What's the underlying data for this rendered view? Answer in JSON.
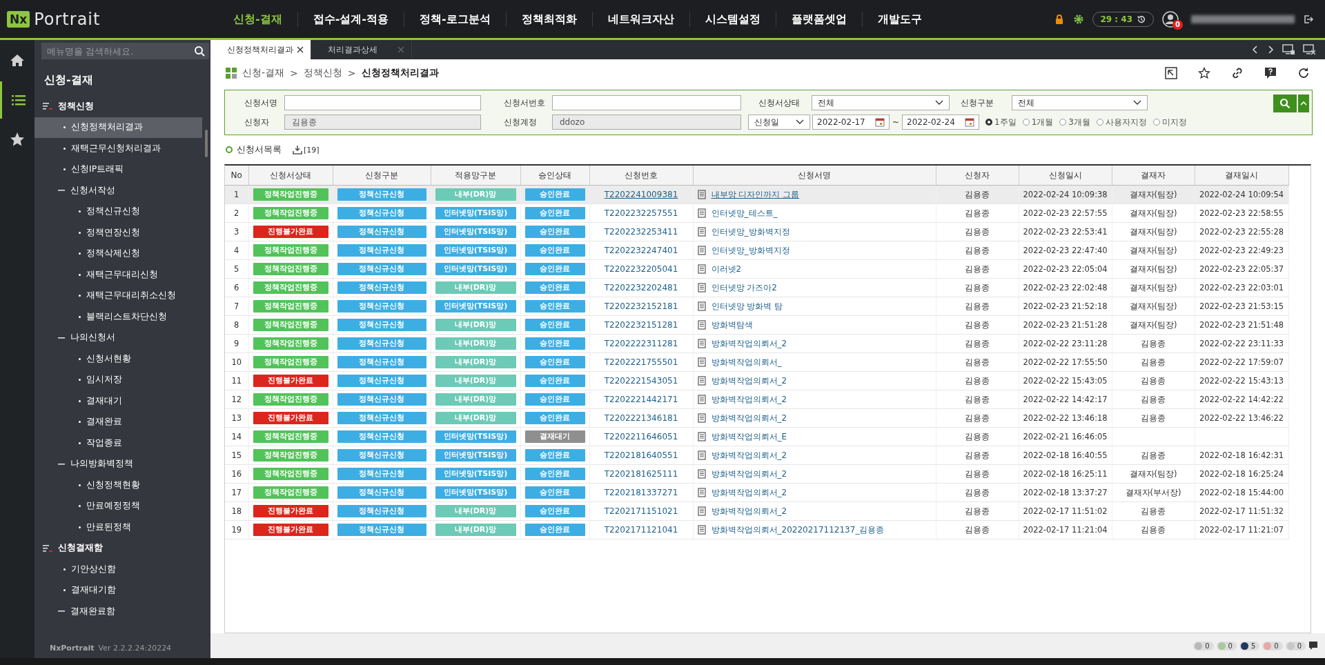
{
  "topbar": {
    "logo_mark": "Nx",
    "logo_text": "Portrait",
    "menu": [
      {
        "label": "신청-결재",
        "selected": true
      },
      {
        "label": "접수-설계-적용",
        "selected": false
      },
      {
        "label": "정책-로그분석",
        "selected": false
      },
      {
        "label": "정책최적화",
        "selected": false
      },
      {
        "label": "네트워크자산",
        "selected": false
      },
      {
        "label": "시스템설정",
        "selected": false
      },
      {
        "label": "플랫폼셋업",
        "selected": false
      },
      {
        "label": "개발도구",
        "selected": false
      }
    ],
    "timer": "29 : 43",
    "notification_count": "0"
  },
  "sidebar": {
    "search": {
      "placeholder": "메뉴명을 검색하세요."
    },
    "title": "신청-결재",
    "tree": [
      {
        "label": "정책신청",
        "kind": "group",
        "children": [
          {
            "label": "신청정책처리결과",
            "kind": "leaf",
            "selected": true
          },
          {
            "label": "재택근무신청처리결과",
            "kind": "leaf",
            "selected": false
          },
          {
            "label": "신청IP트래픽",
            "kind": "leaf",
            "selected": false
          },
          {
            "label": "신청서작성",
            "kind": "folder",
            "expanded": true,
            "children": [
              {
                "label": "정책신규신청",
                "kind": "leaf",
                "selected": false
              },
              {
                "label": "정책연장신청",
                "kind": "leaf",
                "selected": false
              },
              {
                "label": "정책삭제신청",
                "kind": "leaf",
                "selected": false
              },
              {
                "label": "재택근무대리신청",
                "kind": "leaf",
                "selected": false
              },
              {
                "label": "재택근무대리취소신청",
                "kind": "leaf",
                "selected": false
              },
              {
                "label": "블랙리스트차단신청",
                "kind": "leaf",
                "selected": false
              }
            ]
          },
          {
            "label": "나의신청서",
            "kind": "folder",
            "expanded": true,
            "children": [
              {
                "label": "신청서현황",
                "kind": "leaf",
                "selected": false
              },
              {
                "label": "임시저장",
                "kind": "leaf",
                "selected": false
              },
              {
                "label": "결재대기",
                "kind": "leaf",
                "selected": false
              },
              {
                "label": "결재완료",
                "kind": "leaf",
                "selected": false
              },
              {
                "label": "작업종료",
                "kind": "leaf",
                "selected": false
              }
            ]
          },
          {
            "label": "나의방화벽정책",
            "kind": "folder",
            "expanded": true,
            "children": [
              {
                "label": "신청정책현황",
                "kind": "leaf",
                "selected": false
              },
              {
                "label": "만료예정정책",
                "kind": "leaf",
                "selected": false
              },
              {
                "label": "만료된정책",
                "kind": "leaf",
                "selected": false
              }
            ]
          }
        ]
      },
      {
        "label": "신청결재함",
        "kind": "group",
        "children": [
          {
            "label": "기안상신함",
            "kind": "leaf",
            "selected": false
          },
          {
            "label": "결재대기함",
            "kind": "leaf",
            "selected": false
          },
          {
            "label": "결재완료함",
            "kind": "folder",
            "expanded": true
          }
        ]
      }
    ],
    "product": "NxPortrait",
    "version": "Ver 2.2.2.24:20224"
  },
  "tabs": [
    {
      "label": "신청정책처리결과",
      "selected": true
    },
    {
      "label": "처리결과상세",
      "selected": false
    }
  ],
  "breadcrumb": {
    "items": [
      "신청-결재",
      "정책신청",
      "신청정책처리결과"
    ],
    "separator": ">"
  },
  "filters": {
    "row1": [
      {
        "label": "신청서명",
        "kind": "input"
      },
      {
        "label": "신청서번호",
        "kind": "input"
      },
      {
        "label": "신청서상태",
        "kind": "select",
        "value": "전체"
      },
      {
        "label": "신청구분",
        "kind": "select",
        "value": "전체"
      }
    ],
    "row2": [
      {
        "label": "신청자",
        "kind": "readonly",
        "value": "김용종"
      },
      {
        "label": "신청계정",
        "kind": "readonly",
        "value": "ddozo"
      }
    ],
    "date_type": "신청일",
    "date_from": "2022-02-17",
    "date_sep": "~",
    "date_to": "2022-02-24",
    "periods": [
      {
        "label": "1주일",
        "selected": true
      },
      {
        "label": "1개월",
        "selected": false
      },
      {
        "label": "3개월",
        "selected": false
      },
      {
        "label": "사용자지정",
        "selected": false
      },
      {
        "label": "미지정",
        "selected": false
      }
    ]
  },
  "list": {
    "title": "신청서목록",
    "count": "[19]"
  },
  "table": {
    "columns": [
      "No",
      "신청서상태",
      "신청구분",
      "적용망구분",
      "승인상태",
      "신청번호",
      "신청서명",
      "신청자",
      "신청일시",
      "결재자",
      "결재일시"
    ],
    "rows": [
      {
        "no": "1",
        "selected": true,
        "status": {
          "text": "정책작업진행중",
          "kind": "progress"
        },
        "type": "정책신규신청",
        "network": {
          "text": "내부(DR)망",
          "kind": "internal"
        },
        "approval": {
          "text": "승인완료",
          "kind": "done"
        },
        "number": "T2202241009381",
        "name": "내부망 디자인까지 그룹",
        "applicant": "김용종",
        "applied_at": "2022-02-24 10:09:38",
        "approver": "결재자(팀장)",
        "approved_at": "2022-02-24 10:09:54"
      },
      {
        "no": "2",
        "selected": false,
        "status": {
          "text": "정책작업진행중",
          "kind": "progress"
        },
        "type": "정책신규신청",
        "network": {
          "text": "인터넷망(TSIS망)",
          "kind": "internet"
        },
        "approval": {
          "text": "승인완료",
          "kind": "done"
        },
        "number": "T2202232257551",
        "name": "인터넷망_테스트_",
        "applicant": "김용종",
        "applied_at": "2022-02-23 22:57:55",
        "approver": "결재자(팀장)",
        "approved_at": "2022-02-23 22:58:55"
      },
      {
        "no": "3",
        "selected": false,
        "status": {
          "text": "진행불가완료",
          "kind": "failed"
        },
        "type": "정책신규신청",
        "network": {
          "text": "인터넷망(TSIS망)",
          "kind": "internet"
        },
        "approval": {
          "text": "승인완료",
          "kind": "done"
        },
        "number": "T2202232253411",
        "name": "인터넷망_방화벽지정",
        "applicant": "김용종",
        "applied_at": "2022-02-23 22:53:41",
        "approver": "결재자(팀장)",
        "approved_at": "2022-02-23 22:55:28"
      },
      {
        "no": "4",
        "selected": false,
        "status": {
          "text": "정책작업진행중",
          "kind": "progress"
        },
        "type": "정책신규신청",
        "network": {
          "text": "인터넷망(TSIS망)",
          "kind": "internet"
        },
        "approval": {
          "text": "승인완료",
          "kind": "done"
        },
        "number": "T2202232247401",
        "name": "인터넷망_방화벽지정",
        "applicant": "김용종",
        "applied_at": "2022-02-23 22:47:40",
        "approver": "결재자(팀장)",
        "approved_at": "2022-02-23 22:49:23"
      },
      {
        "no": "5",
        "selected": false,
        "status": {
          "text": "정책작업진행중",
          "kind": "progress"
        },
        "type": "정책신규신청",
        "network": {
          "text": "인터넷망(TSIS망)",
          "kind": "internet"
        },
        "approval": {
          "text": "승인완료",
          "kind": "done"
        },
        "number": "T2202232205041",
        "name": "이러넷2",
        "applicant": "김용종",
        "applied_at": "2022-02-23 22:05:04",
        "approver": "결재자(팀장)",
        "approved_at": "2022-02-23 22:05:37"
      },
      {
        "no": "6",
        "selected": false,
        "status": {
          "text": "정책작업진행중",
          "kind": "progress"
        },
        "type": "정책신규신청",
        "network": {
          "text": "내부(DR)망",
          "kind": "internal"
        },
        "approval": {
          "text": "승인완료",
          "kind": "done"
        },
        "number": "T2202232202481",
        "name": "인터넷망 가즈아2",
        "applicant": "김용종",
        "applied_at": "2022-02-23 22:02:48",
        "approver": "결재자(팀장)",
        "approved_at": "2022-02-23 22:03:01"
      },
      {
        "no": "7",
        "selected": false,
        "status": {
          "text": "정책작업진행중",
          "kind": "progress"
        },
        "type": "정책신규신청",
        "network": {
          "text": "인터넷망(TSIS망)",
          "kind": "internet"
        },
        "approval": {
          "text": "승인완료",
          "kind": "done"
        },
        "number": "T2202232152181",
        "name": "인터넷망 방화벽 탐",
        "applicant": "김용종",
        "applied_at": "2022-02-23 21:52:18",
        "approver": "결재자(팀장)",
        "approved_at": "2022-02-23 21:53:15"
      },
      {
        "no": "8",
        "selected": false,
        "status": {
          "text": "정책작업진행중",
          "kind": "progress"
        },
        "type": "정책신규신청",
        "network": {
          "text": "내부(DR)망",
          "kind": "internal"
        },
        "approval": {
          "text": "승인완료",
          "kind": "done"
        },
        "number": "T2202232151281",
        "name": "방화벽탐색",
        "applicant": "김용종",
        "applied_at": "2022-02-23 21:51:28",
        "approver": "결재자(팀장)",
        "approved_at": "2022-02-23 21:51:48"
      },
      {
        "no": "9",
        "selected": false,
        "status": {
          "text": "정책작업진행중",
          "kind": "progress"
        },
        "type": "정책신규신청",
        "network": {
          "text": "내부(DR)망",
          "kind": "internal"
        },
        "approval": {
          "text": "승인완료",
          "kind": "done"
        },
        "number": "T2202222311281",
        "name": "방화벽작업의뢰서_2",
        "applicant": "김용종",
        "applied_at": "2022-02-22 23:11:28",
        "approver": "김용종",
        "approved_at": "2022-02-22 23:11:33"
      },
      {
        "no": "10",
        "selected": false,
        "status": {
          "text": "정책작업진행중",
          "kind": "progress"
        },
        "type": "정책신규신청",
        "network": {
          "text": "내부(DR)망",
          "kind": "internal"
        },
        "approval": {
          "text": "승인완료",
          "kind": "done"
        },
        "number": "T2202221755501",
        "name": "방화벽작업의뢰서_",
        "applicant": "김용종",
        "applied_at": "2022-02-22 17:55:50",
        "approver": "김용종",
        "approved_at": "2022-02-22 17:59:07"
      },
      {
        "no": "11",
        "selected": false,
        "status": {
          "text": "진행불가완료",
          "kind": "failed"
        },
        "type": "정책신규신청",
        "network": {
          "text": "내부(DR)망",
          "kind": "internal"
        },
        "approval": {
          "text": "승인완료",
          "kind": "done"
        },
        "number": "T2202221543051",
        "name": "방화벽작업의뢰서_2",
        "applicant": "김용종",
        "applied_at": "2022-02-22 15:43:05",
        "approver": "김용종",
        "approved_at": "2022-02-22 15:43:13"
      },
      {
        "no": "12",
        "selected": false,
        "status": {
          "text": "정책작업진행중",
          "kind": "progress"
        },
        "type": "정책신규신청",
        "network": {
          "text": "내부(DR)망",
          "kind": "internal"
        },
        "approval": {
          "text": "승인완료",
          "kind": "done"
        },
        "number": "T2202221442171",
        "name": "방화벽작업의뢰서_2",
        "applicant": "김용종",
        "applied_at": "2022-02-22 14:42:17",
        "approver": "김용종",
        "approved_at": "2022-02-22 14:42:22"
      },
      {
        "no": "13",
        "selected": false,
        "status": {
          "text": "진행불가완료",
          "kind": "failed"
        },
        "type": "정책신규신청",
        "network": {
          "text": "내부(DR)망",
          "kind": "internal"
        },
        "approval": {
          "text": "승인완료",
          "kind": "done"
        },
        "number": "T2202221346181",
        "name": "방화벽작업의뢰서_2",
        "applicant": "김용종",
        "applied_at": "2022-02-22 13:46:18",
        "approver": "김용종",
        "approved_at": "2022-02-22 13:46:22"
      },
      {
        "no": "14",
        "selected": false,
        "status": {
          "text": "정책작업진행중",
          "kind": "progress"
        },
        "type": "정책신규신청",
        "network": {
          "text": "인터넷망(TSIS망)",
          "kind": "internet"
        },
        "approval": {
          "text": "결재대기",
          "kind": "waiting"
        },
        "number": "T2202211646051",
        "name": "방화벽작업의뢰서_E",
        "applicant": "김용종",
        "applied_at": "2022-02-21 16:46:05"
      },
      {
        "no": "15",
        "selected": false,
        "status": {
          "text": "정책작업진행중",
          "kind": "progress"
        },
        "type": "정책신규신청",
        "network": {
          "text": "인터넷망(TSIS망)",
          "kind": "internet"
        },
        "approval": {
          "text": "승인완료",
          "kind": "done"
        },
        "number": "T2202181640551",
        "name": "방화벽작업의뢰서_2",
        "applicant": "김용종",
        "applied_at": "2022-02-18 16:40:55",
        "approver": "김용종",
        "approved_at": "2022-02-18 16:42:31"
      },
      {
        "no": "16",
        "selected": false,
        "status": {
          "text": "정책작업진행중",
          "kind": "progress"
        },
        "type": "정책신규신청",
        "network": {
          "text": "인터넷망(TSIS망)",
          "kind": "internet"
        },
        "approval": {
          "text": "승인완료",
          "kind": "done"
        },
        "number": "T2202181625111",
        "name": "방화벽작업의뢰서_2",
        "applicant": "김용종",
        "applied_at": "2022-02-18 16:25:11",
        "approver": "결재자(팀장)",
        "approved_at": "2022-02-18 16:25:24"
      },
      {
        "no": "17",
        "selected": false,
        "status": {
          "text": "정책작업진행중",
          "kind": "progress"
        },
        "type": "정책신규신청",
        "network": {
          "text": "인터넷망(TSIS망)",
          "kind": "internet"
        },
        "approval": {
          "text": "승인완료",
          "kind": "done"
        },
        "number": "T2202181337271",
        "name": "방화벽작업의뢰서_2",
        "applicant": "김용종",
        "applied_at": "2022-02-18 13:37:27",
        "approver": "결재자(부서장)",
        "approved_at": "2022-02-18 15:44:00"
      },
      {
        "no": "18",
        "selected": false,
        "status": {
          "text": "진행불가완료",
          "kind": "failed"
        },
        "type": "정책신규신청",
        "network": {
          "text": "내부(DR)망",
          "kind": "internal"
        },
        "approval": {
          "text": "승인완료",
          "kind": "done"
        },
        "number": "T2202171151021",
        "name": "방화벽작업의뢰서_2",
        "applicant": "김용종",
        "applied_at": "2022-02-17 11:51:02",
        "approver": "김용종",
        "approved_at": "2022-02-17 11:51:32"
      },
      {
        "no": "19",
        "selected": false,
        "status": {
          "text": "진행불가완료",
          "kind": "failed"
        },
        "type": "정책신규신청",
        "network": {
          "text": "내부(DR)망",
          "kind": "internal"
        },
        "approval": {
          "text": "승인완료",
          "kind": "done"
        },
        "number": "T2202171121041",
        "name": "방화벽작업의뢰서_20220217112137_김용종",
        "applicant": "김용종",
        "applied_at": "2022-02-17 11:21:04",
        "approver": "김용종",
        "approved_at": "2022-02-17 11:21:07"
      }
    ]
  },
  "status_counters": [
    {
      "count": "0",
      "color": "#b8b8b8"
    },
    {
      "count": "0",
      "color": "#a8c8a0"
    },
    {
      "count": "5",
      "color": "#1f3a5c"
    },
    {
      "count": "0",
      "color": "#e8a8a8"
    },
    {
      "count": "0",
      "color": "#c8c8c8"
    }
  ]
}
